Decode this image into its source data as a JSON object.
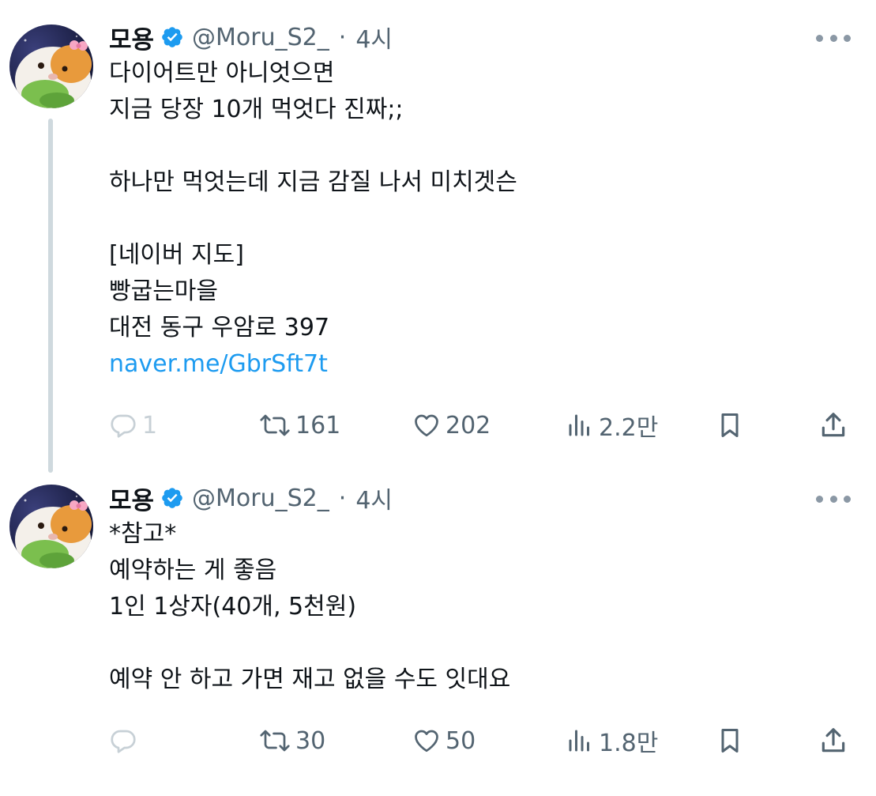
{
  "tweets": [
    {
      "display_name": "모용",
      "handle": "@Moru_S2_",
      "separator": "·",
      "time": "4시",
      "lines": [
        "다이어트만 아니엇으면",
        "지금 당장 10개 먹엇다 진짜;;",
        "",
        "하나만 먹엇는데 지금 감질 나서 미치겟슨",
        "",
        "[네이버 지도]",
        "빵굽는마을",
        "대전 동구 우암로 397"
      ],
      "link": "naver.me/GbrSft7t",
      "replies": "1",
      "retweets": "161",
      "likes": "202",
      "views": "2.2만"
    },
    {
      "display_name": "모용",
      "handle": "@Moru_S2_",
      "separator": "·",
      "time": "4시",
      "lines": [
        "*참고*",
        "예약하는 게 좋음",
        "1인 1상자(40개, 5천원)",
        "",
        "예약 안 하고 가면 재고 없을 수도 잇대요"
      ],
      "retweets": "30",
      "likes": "50",
      "views": "1.8만"
    }
  ],
  "colors": {
    "text": "#0f1419",
    "secondary": "#536471",
    "link": "#1d9bf0",
    "verified": "#1d9bf0",
    "thread_line": "#cfd9de"
  }
}
